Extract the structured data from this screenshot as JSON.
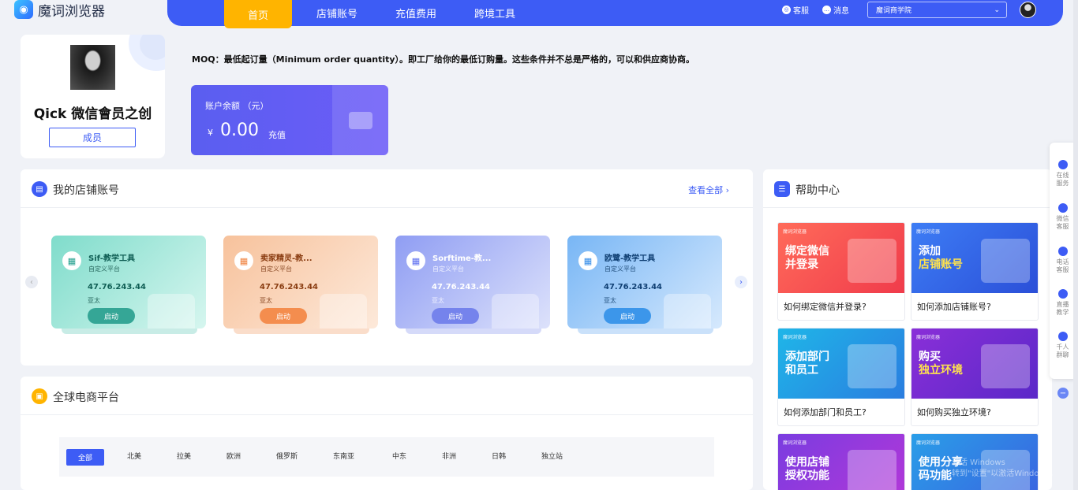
{
  "app": {
    "logo_text": "魔词浏览器"
  },
  "nav": {
    "tabs": [
      "首页",
      "店铺账号",
      "充值费用",
      "跨境工具"
    ],
    "service": "客服",
    "message": "消息",
    "school_select": "魔词商学院"
  },
  "profile": {
    "name": "Qick 微信會员之创",
    "role": "成员"
  },
  "moq_notice": "MOQ：最低起订量（Minimum order quantity）。即工厂给你的最低订购量。这些条件并不总是严格的，可以和供应商协商。",
  "balance": {
    "label": "账户余额 （元）",
    "currency": "¥",
    "amount": "0.00",
    "recharge": "充值"
  },
  "stores": {
    "title": "我的店铺账号",
    "view_all": "查看全部",
    "cards": [
      {
        "name": "Sif-教学工具",
        "platform": "自定义平台",
        "ip": "47.76.243.44",
        "region": "亚太",
        "button": "启动",
        "accent": "#1f9e8c"
      },
      {
        "name": "卖家精灵-教...",
        "platform": "自定义平台",
        "ip": "47.76.243.44",
        "region": "亚太",
        "button": "启动",
        "accent": "#f0803c"
      },
      {
        "name": "Sorftime-教...",
        "platform": "自定义平台",
        "ip": "47.76.243.44",
        "region": "亚太",
        "button": "启动",
        "accent": "#5a6cf0"
      },
      {
        "name": "欧鹭-教学工具",
        "platform": "自定义平台",
        "ip": "47.76.243.44",
        "region": "亚太",
        "button": "启动",
        "accent": "#2f8ae8"
      }
    ]
  },
  "platforms": {
    "title": "全球电商平台",
    "regions": [
      "全部",
      "北美",
      "拉美",
      "欧洲",
      "俄罗斯",
      "东南亚",
      "中东",
      "非洲",
      "日韩",
      "独立站"
    ]
  },
  "help": {
    "title": "帮助中心",
    "tag": "魔词浏览器",
    "cards": [
      {
        "img_line1": "绑定微信",
        "img_line2": "并登录",
        "caption": "如何绑定微信并登录?"
      },
      {
        "img_line1": "添加",
        "img_line2": "店铺账号",
        "caption": "如何添加店铺账号?"
      },
      {
        "img_line1": "添加部门",
        "img_line2": "和员工",
        "caption": "如何添加部门和员工?"
      },
      {
        "img_line1": "购买",
        "img_line2": "独立环境",
        "caption": "如何购买独立环境?"
      },
      {
        "img_line1": "使用店铺",
        "img_line2": "授权功能",
        "caption": ""
      },
      {
        "img_line1": "使用分享",
        "img_line2": "码功能",
        "caption": ""
      }
    ]
  },
  "float_bar": [
    {
      "line1": "在线",
      "line2": "服务"
    },
    {
      "line1": "微信",
      "line2": "客服"
    },
    {
      "line1": "电话",
      "line2": "客服"
    },
    {
      "line1": "直播",
      "line2": "教学"
    },
    {
      "line1": "千人",
      "line2": "群聊"
    }
  ],
  "watermark": {
    "line1": "激活 Windows",
    "line2": "转到\"设置\"以激活Windows。"
  }
}
